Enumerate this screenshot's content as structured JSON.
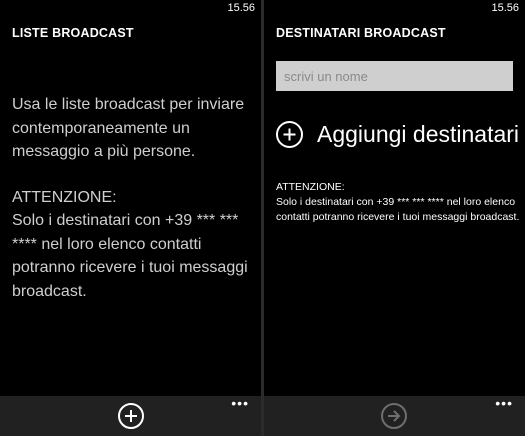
{
  "left_panel": {
    "time": "15.56",
    "title": "LISTE BROADCAST",
    "description": "Usa le liste broadcast per inviare contemporaneamente un messaggio a più persone.",
    "warning_heading": "ATTENZIONE:",
    "warning_text": "Solo i destinatari con +39 *** *** **** nel loro elenco contatti potranno ricevere i tuoi messaggi broadcast.",
    "appbar": {
      "button_icon": "add-circle-icon",
      "more": "•••"
    }
  },
  "right_panel": {
    "time": "15.56",
    "title": "DESTINATARI BROADCAST",
    "name_input": {
      "value": "",
      "placeholder": "scrivi un nome"
    },
    "add_recipients_label": "Aggiungi destinatari",
    "warning_heading": "ATTENZIONE:",
    "warning_text": "Solo i destinatari con +39 *** *** **** nel loro elenco contatti potranno ricevere i tuoi messaggi broadcast.",
    "appbar": {
      "button_icon": "next-arrow-icon",
      "more": "•••"
    }
  },
  "colors": {
    "background": "#000000",
    "appbar": "#212121",
    "input_bg": "#cfcfcf",
    "body_text_dim": "#cfcfcf",
    "disabled_icon": "#6e6e6e"
  }
}
